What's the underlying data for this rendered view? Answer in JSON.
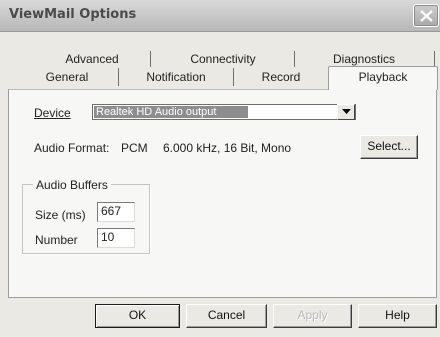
{
  "window": {
    "title": "ViewMail Options"
  },
  "tabs": {
    "row1": [
      "Advanced",
      "Connectivity",
      "Diagnostics"
    ],
    "row2": [
      "General",
      "Notification",
      "Record"
    ],
    "active": "Playback"
  },
  "playback": {
    "device_label": "Device",
    "device_value": "Realtek HD Audio output",
    "audio_format_label": "Audio Format:",
    "audio_format_codec": "PCM",
    "audio_format_detail": "6.000 kHz, 16 Bit, Mono",
    "select_button": "Select...",
    "buffers": {
      "group_title": "Audio Buffers",
      "size_label": "Size (ms)",
      "size_value": "667",
      "number_label": "Number",
      "number_value": "10"
    }
  },
  "buttons": {
    "ok": "OK",
    "cancel": "Cancel",
    "apply": "Apply",
    "help": "Help"
  },
  "icons": {
    "close": "close-icon",
    "dropdown": "chevron-down-icon"
  },
  "colors": {
    "dialog_bg": "#ebe9e3",
    "panel_bg": "#f7f7f5",
    "selection_bg": "#8d8d8d"
  }
}
